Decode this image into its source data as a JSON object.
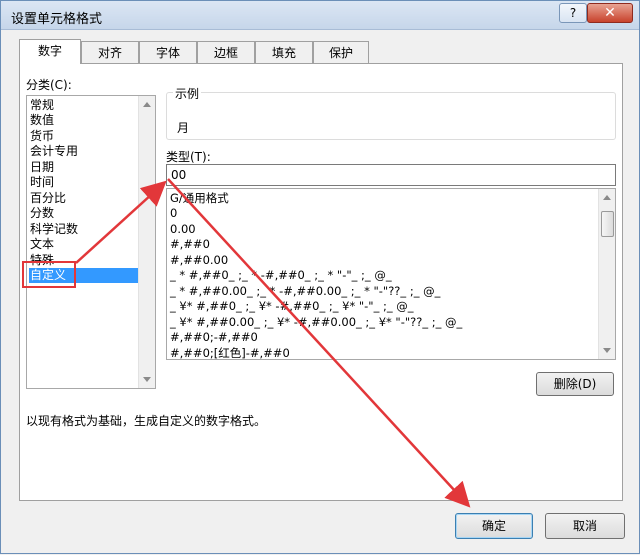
{
  "window": {
    "title": "设置单元格格式",
    "help_label": "?",
    "close_label": "✕"
  },
  "tabs": [
    {
      "label": "数字",
      "active": true
    },
    {
      "label": "对齐",
      "active": false
    },
    {
      "label": "字体",
      "active": false
    },
    {
      "label": "边框",
      "active": false
    },
    {
      "label": "填充",
      "active": false
    },
    {
      "label": "保护",
      "active": false
    }
  ],
  "category": {
    "label": "分类(C):",
    "items": [
      "常规",
      "数值",
      "货币",
      "会计专用",
      "日期",
      "时间",
      "百分比",
      "分数",
      "科学记数",
      "文本",
      "特殊",
      "自定义"
    ],
    "selected": "自定义"
  },
  "sample": {
    "label": "示例",
    "value": "月"
  },
  "type": {
    "label": "类型(T):",
    "value": "00"
  },
  "formats": [
    "G/通用格式",
    "0",
    "0.00",
    "#,##0",
    "#,##0.00",
    "_ * #,##0_ ;_ * -#,##0_ ;_ * \"-\"_ ;_ @_",
    "_ * #,##0.00_ ;_ * -#,##0.00_ ;_ * \"-\"??_ ;_ @_",
    "_ ¥* #,##0_ ;_ ¥* -#,##0_ ;_ ¥* \"-\"_ ;_ @_",
    "_ ¥* #,##0.00_ ;_ ¥* -#,##0.00_ ;_ ¥* \"-\"??_ ;_ @_",
    "#,##0;-#,##0",
    "#,##0;[红色]-#,##0"
  ],
  "delete_label": "删除(D)",
  "description": "以现有格式为基础，生成自定义的数字格式。",
  "ok_label": "确定",
  "cancel_label": "取消",
  "annotation_color": "#e2373a"
}
